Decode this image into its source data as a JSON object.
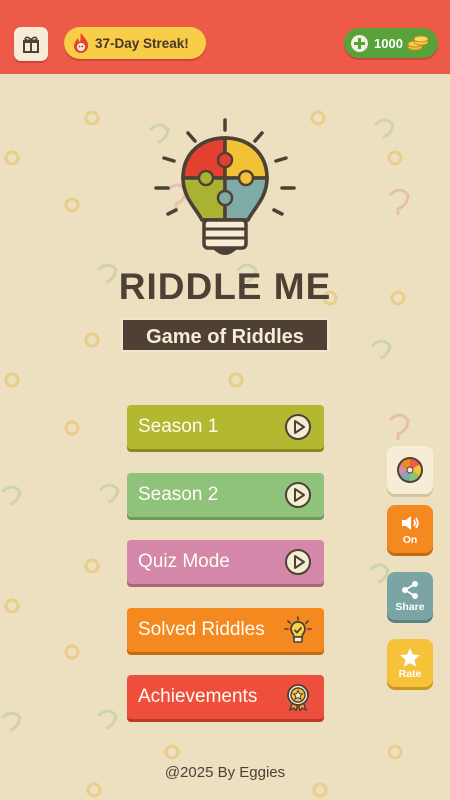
{
  "header": {
    "streak_text": "37-Day Streak!",
    "coins_amount": "1000"
  },
  "logo": {
    "title": "RIDDLE ME",
    "subtitle": "Game of Riddles"
  },
  "menu": [
    {
      "label": "Season 1",
      "color": "#b2b930",
      "icon": "play-icon"
    },
    {
      "label": "Season 2",
      "color": "#8fc27b",
      "icon": "play-icon"
    },
    {
      "label": "Quiz Mode",
      "color": "#d487a8",
      "icon": "play-icon"
    },
    {
      "label": "Solved Riddles",
      "color": "#f4891f",
      "icon": "lightbulb-icon"
    },
    {
      "label": "Achievements",
      "color": "#ee4f3c",
      "icon": "medal-icon"
    }
  ],
  "side": {
    "spin_label": "",
    "sound_label": "On",
    "share_label": "Share",
    "rate_label": "Rate"
  },
  "footer": {
    "text": "@2025 By Eggies"
  },
  "colors": {
    "background": "#ece0c0",
    "header": "#ee5a48",
    "dark": "#4e4035",
    "sound": "#f4891f",
    "share": "#7aa5a4",
    "rate": "#f6c23a"
  }
}
